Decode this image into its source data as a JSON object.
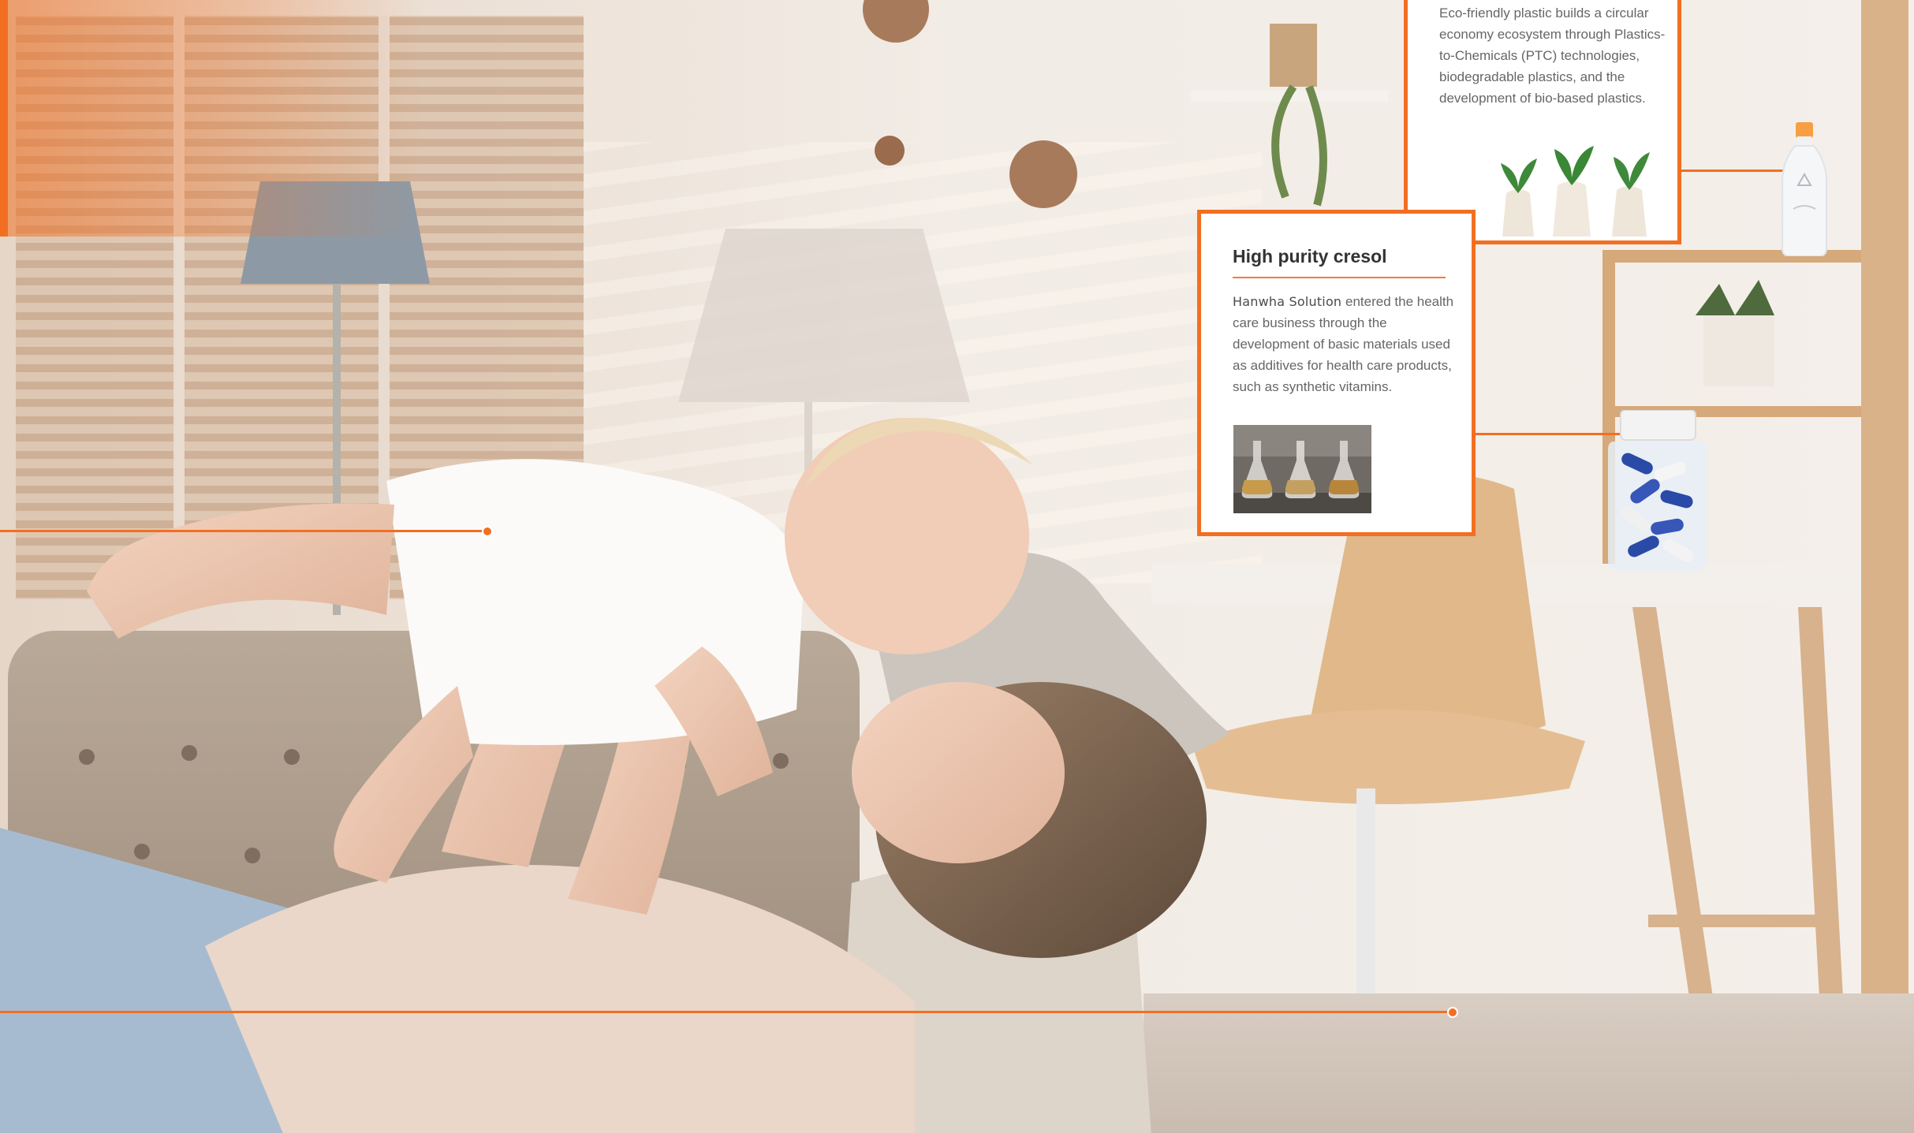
{
  "colors": {
    "accent": "#f26f21",
    "card_background": "#ffffff",
    "title_text": "#333333",
    "body_text": "#666666"
  },
  "eco_plastic_card": {
    "body": "Eco-friendly plastic builds a circular economy ecosystem through Plastics-to-Chemicals (PTC) technologies, biodegradable plastics, and the development of bio-based plastics.",
    "image_icon": "plant-bottles-image"
  },
  "cresol_card": {
    "title": "High purity cresol",
    "brand": "Hanwha Solution",
    "body": "entered the health care business through the development of basic materials used as additives for health care products, such as synthetic vitamins.",
    "image_icon": "lab-flasks-image"
  },
  "product_icons": [
    "plastic-bottle-icon",
    "capsule-jar-icon"
  ]
}
